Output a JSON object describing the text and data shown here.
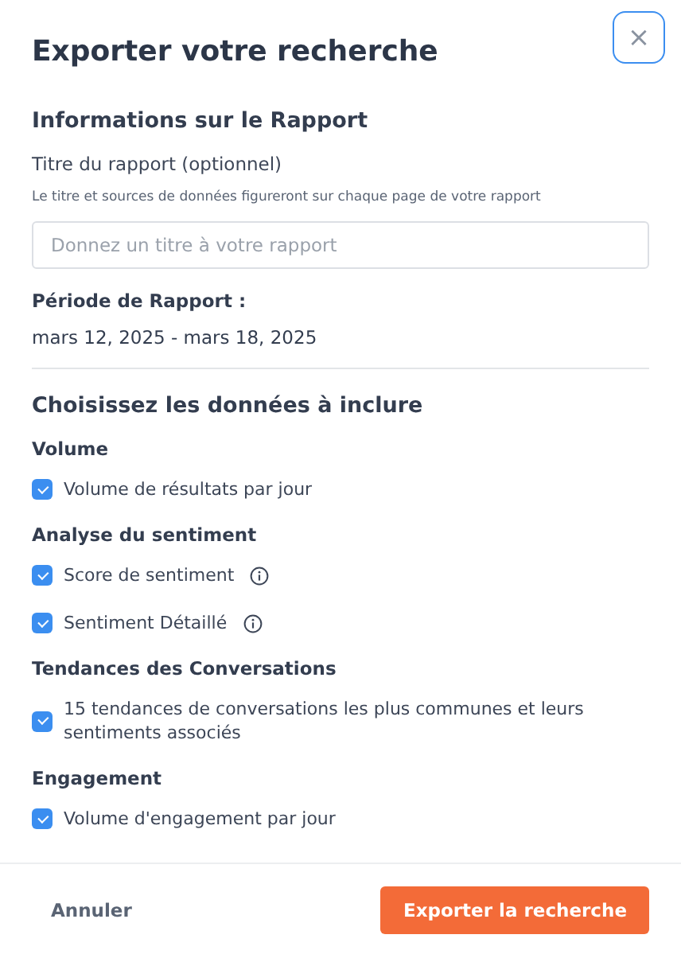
{
  "dialog": {
    "title": "Exporter votre recherche",
    "close_label": "×"
  },
  "report_info": {
    "heading": "Informations sur le Rapport",
    "field_label": "Titre du rapport (optionnel)",
    "hint": "Le titre et sources de données figureront sur chaque page de votre rapport",
    "title_field": {
      "placeholder": "Donnez un titre à votre rapport"
    },
    "period_label": "Période de Rapport :",
    "period": "mars 12, 2025 - mars 18, 2025"
  },
  "data_section": {
    "heading": "Choisissez les données à inclure",
    "groups": [
      {
        "title": "Volume",
        "items": [
          {
            "label": "Volume de résultats par jour",
            "checked": true,
            "info": false
          }
        ]
      },
      {
        "title": "Analyse du sentiment",
        "items": [
          {
            "label": "Score de sentiment",
            "checked": true,
            "info": true
          },
          {
            "label": "Sentiment Détaillé",
            "checked": true,
            "info": true
          }
        ]
      },
      {
        "title": "Tendances des Conversations",
        "items": [
          {
            "label": "15 tendances de conversations les plus communes et leurs sentiments associés",
            "checked": true,
            "info": false
          }
        ]
      },
      {
        "title": "Engagement",
        "items": [
          {
            "label": "Volume d'engagement par jour",
            "checked": true,
            "info": false
          }
        ]
      }
    ]
  },
  "footer": {
    "cancel": "Annuler",
    "export": "Exporter la recherche"
  }
}
